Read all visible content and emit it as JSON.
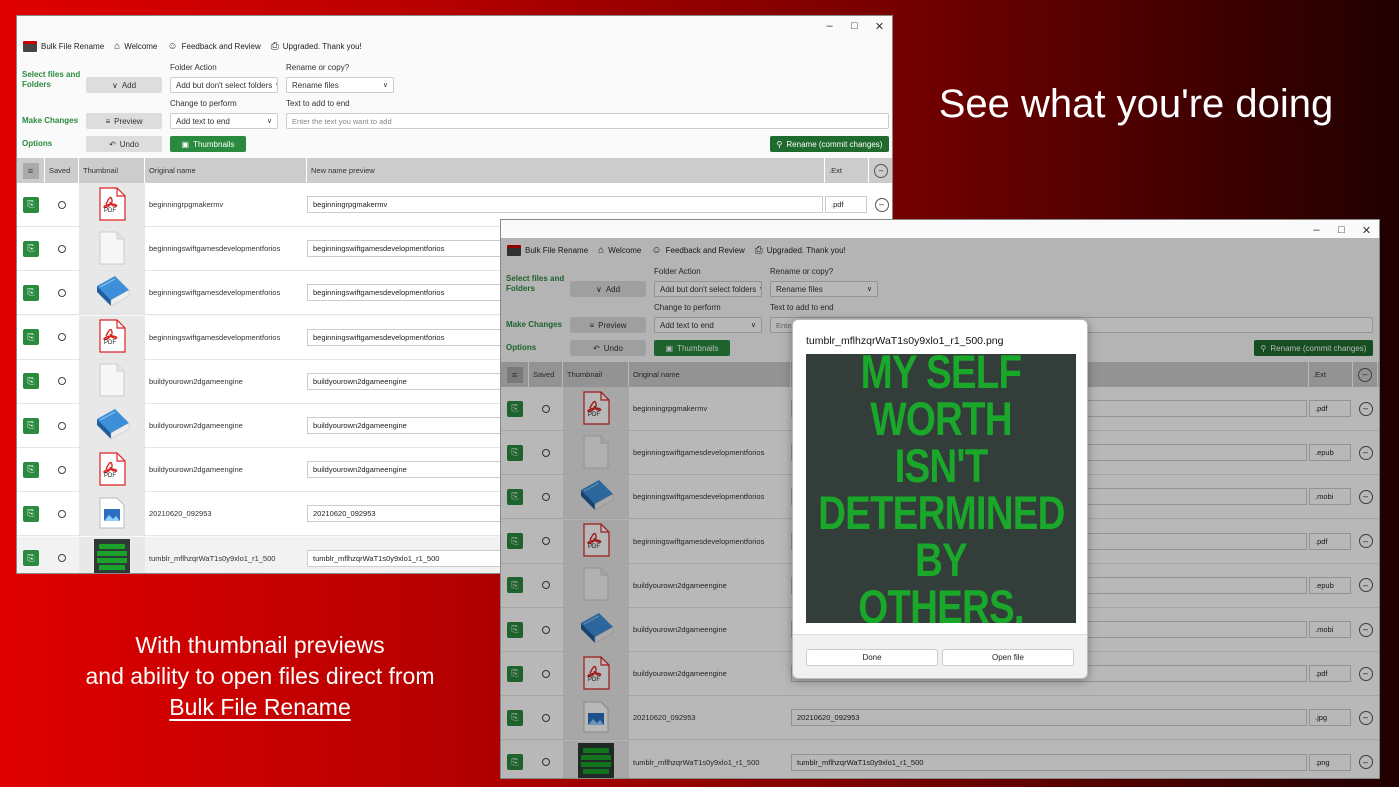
{
  "promo": {
    "headline": "See what you're doing",
    "caption_line1": "With thumbnail previews",
    "caption_line2": "and ability to open files direct from",
    "caption_link": "Bulk File Rename"
  },
  "window": {
    "title": "Bulk File Rename",
    "menu": [
      "Welcome",
      "Feedback and Review",
      "Upgraded.  Thank you!"
    ],
    "caption_buttons": [
      "–",
      "□",
      "✕"
    ]
  },
  "controls": {
    "section_select": "Select files and Folders",
    "section_changes": "Make Changes",
    "section_options": "Options",
    "add_label": "Add",
    "preview_label": "Preview",
    "undo_label": "Undo",
    "thumbnails_label": "Thumbnails",
    "folder_action_label": "Folder Action",
    "folder_action_value": "Add but don't select folders",
    "rename_or_copy_label": "Rename or copy?",
    "rename_or_copy_value": "Rename files",
    "change_label": "Change to perform",
    "change_value": "Add text to end",
    "text_to_add_label": "Text to add to end",
    "text_to_add_placeholder": "Enter the text you want to add",
    "commit_label": "Rename (commit changes)"
  },
  "table": {
    "headers": [
      "Saved",
      "Thumbnail",
      "Original name",
      "New name preview",
      ".Ext"
    ],
    "rows": [
      {
        "original": "beginningrpgmakermv",
        "preview": "beginningrpgmakermv",
        "ext": ".pdf",
        "thumb": "pdf-icon"
      },
      {
        "original": "beginningswiftgamesdevelopmentforios",
        "preview": "beginningswiftgamesdevelopmentforios",
        "ext": ".epub",
        "thumb": "blank-page-icon"
      },
      {
        "original": "beginningswiftgamesdevelopmentforios",
        "preview": "beginningswiftgamesdevelopmentforios",
        "ext": ".mobi",
        "thumb": "book-icon"
      },
      {
        "original": "beginningswiftgamesdevelopmentforios",
        "preview": "beginningswiftgamesdevelopmentforios",
        "ext": ".pdf",
        "thumb": "pdf-icon"
      },
      {
        "original": "buildyourown2dgameengine",
        "preview": "buildyourown2dgameengine",
        "ext": ".epub",
        "thumb": "blank-page-icon"
      },
      {
        "original": "buildyourown2dgameengine",
        "preview": "buildyourown2dgameengine",
        "ext": ".mobi",
        "thumb": "book-icon"
      },
      {
        "original": "buildyourown2dgameengine",
        "preview": "buildyourown2dgameengine",
        "ext": ".pdf",
        "thumb": "pdf-icon"
      },
      {
        "original": "20210620_092953",
        "preview": "20210620_092953",
        "ext": ".jpg",
        "thumb": "image-file-icon"
      },
      {
        "original": "tumblr_mflhzqrWaT1s0y9xlo1_r1_500",
        "preview": "tumblr_mflhzqrWaT1s0y9xlo1_r1_500",
        "ext": ".png",
        "thumb": "quote-image-thumb"
      }
    ]
  },
  "dialog": {
    "title": "tumblr_mflhzqrWaT1s0y9xlo1_r1_500.png",
    "image_text": [
      "MY SELF",
      "WORTH ISN'T",
      "DETERMINED",
      "BY OTHERS."
    ],
    "done_label": "Done",
    "open_label": "Open file"
  },
  "pdf_label": "PDF",
  "colors": {
    "accent": "#2a8a3e",
    "commit": "#1f6b2e",
    "quote": "#19a82a",
    "image_bg": "#333d3a"
  }
}
